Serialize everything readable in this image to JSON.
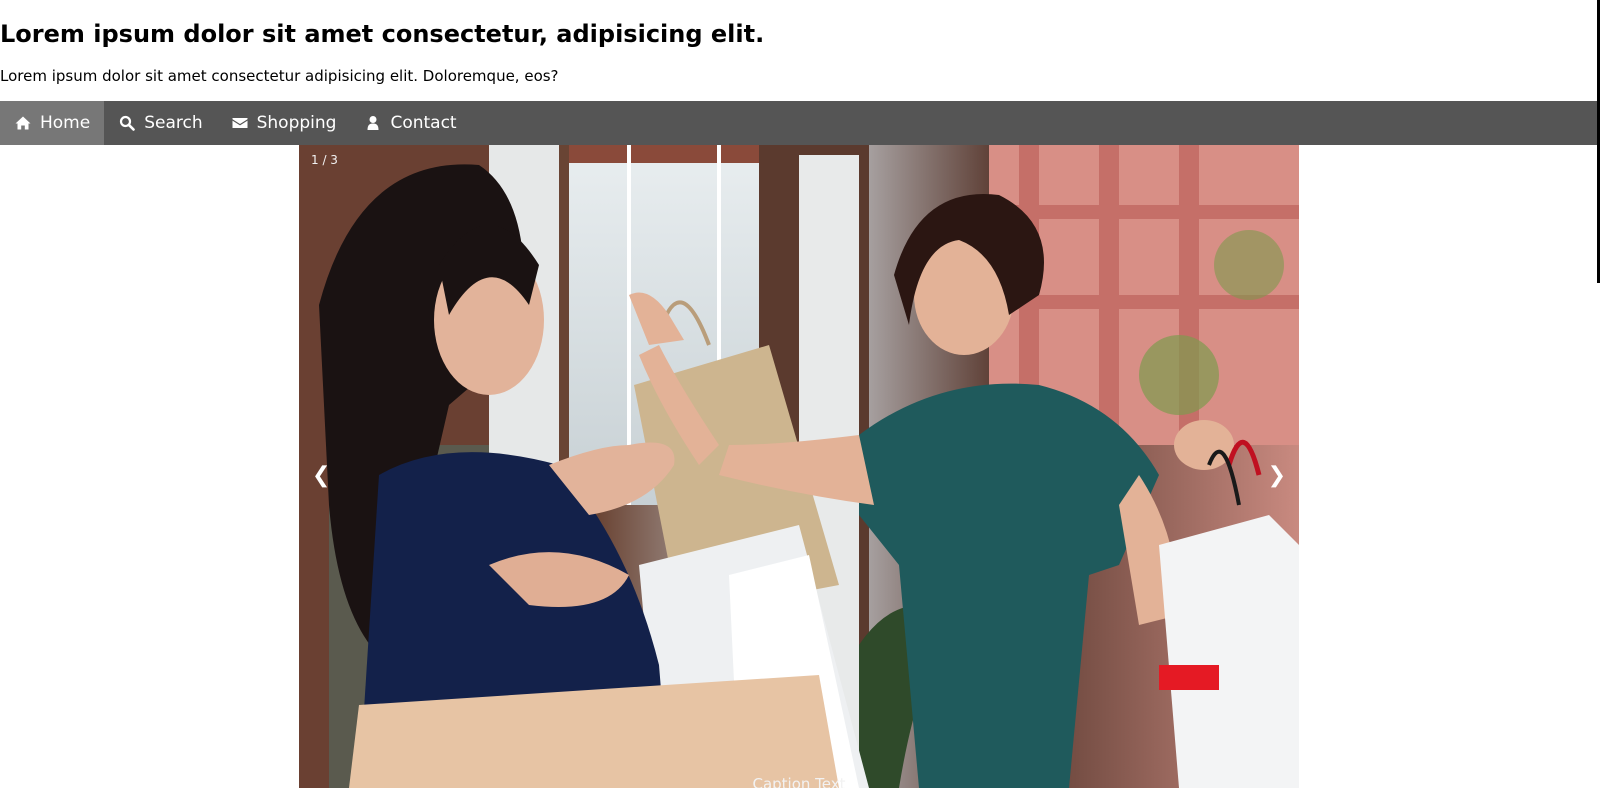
{
  "header": {
    "title": "Lorem ipsum dolor sit amet consectetur, adipisicing elit.",
    "subtitle": "Lorem ipsum dolor sit amet consectetur adipisicing elit. Doloremque, eos?"
  },
  "nav": {
    "items": [
      {
        "label": "Home",
        "icon": "home-icon",
        "active": true
      },
      {
        "label": "Search",
        "icon": "search-icon"
      },
      {
        "label": "Shopping",
        "icon": "envelope-icon"
      },
      {
        "label": "Contact",
        "icon": "user-icon"
      }
    ]
  },
  "slideshow": {
    "counter": "1 / 3",
    "prev_label": "❮",
    "next_label": "❯",
    "caption": "Caption Text"
  },
  "colors": {
    "navbar": "#555555",
    "nav_active": "#777777",
    "text_light": "#f2f2f2"
  }
}
